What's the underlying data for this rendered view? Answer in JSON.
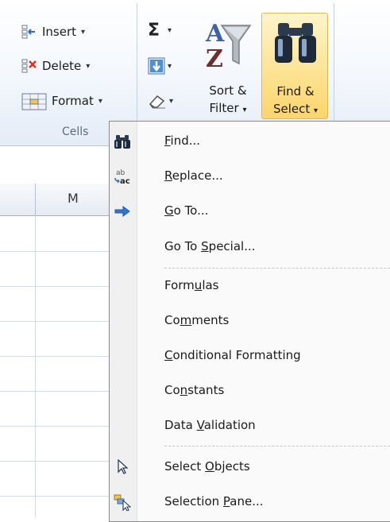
{
  "ribbon": {
    "cells_group": {
      "insert_label": "Insert",
      "delete_label": "Delete",
      "format_label": "Format",
      "group_label": "Cells",
      "dropdown_arrow": "▾"
    },
    "editing_group": {
      "autosum_symbol": "Σ",
      "sort_filter_line1": "Sort &",
      "sort_filter_line2": "Filter",
      "find_select_line1": "Find &",
      "find_select_line2": "Select",
      "dropdown_arrow": "▾"
    }
  },
  "sheet": {
    "column_letter": "M"
  },
  "menu": {
    "items": [
      {
        "icon": "binoculars-icon",
        "pre": "",
        "key": "F",
        "post": "ind..."
      },
      {
        "icon": "replace-icon",
        "pre": "",
        "key": "R",
        "post": "eplace..."
      },
      {
        "icon": "arrow-right-icon",
        "pre": "",
        "key": "G",
        "post": "o To..."
      },
      {
        "icon": "",
        "pre": "Go To ",
        "key": "S",
        "post": "pecial..."
      },
      {
        "icon": "",
        "pre": "Form",
        "key": "u",
        "post": "las"
      },
      {
        "icon": "",
        "pre": "Co",
        "key": "m",
        "post": "ments"
      },
      {
        "icon": "",
        "pre": "",
        "key": "C",
        "post": "onditional Formatting"
      },
      {
        "icon": "",
        "pre": "Co",
        "key": "n",
        "post": "stants"
      },
      {
        "icon": "",
        "pre": "Data ",
        "key": "V",
        "post": "alidation"
      },
      {
        "icon": "cursor-arrow-icon",
        "pre": "Select ",
        "key": "O",
        "post": "bjects"
      },
      {
        "icon": "selection-pane-icon",
        "pre": "Selection ",
        "key": "P",
        "post": "ane..."
      }
    ]
  }
}
